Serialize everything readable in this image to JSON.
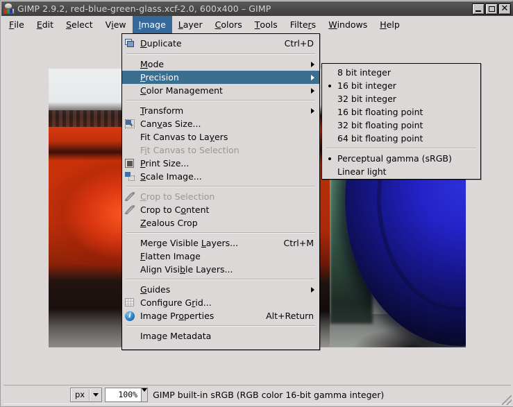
{
  "window": {
    "title": "GIMP 2.9.2, red-blue-green-glass.xcf-2.0, 600x400 – GIMP",
    "app_icon": "gimp-wilber-icon",
    "minimize_label": "_",
    "maximize_label": "□",
    "close_label": "✕"
  },
  "menubar": {
    "items": [
      {
        "label": "File",
        "mnemonic": "F",
        "active": false
      },
      {
        "label": "Edit",
        "mnemonic": "E",
        "active": false
      },
      {
        "label": "Select",
        "mnemonic": "S",
        "active": false
      },
      {
        "label": "View",
        "mnemonic": "V",
        "active": false
      },
      {
        "label": "Image",
        "mnemonic": "I",
        "active": true
      },
      {
        "label": "Layer",
        "mnemonic": "L",
        "active": false
      },
      {
        "label": "Colors",
        "mnemonic": "C",
        "active": false
      },
      {
        "label": "Tools",
        "mnemonic": "T",
        "active": false
      },
      {
        "label": "Filters",
        "mnemonic": "r",
        "active": false
      },
      {
        "label": "Windows",
        "mnemonic": "W",
        "active": false
      },
      {
        "label": "Help",
        "mnemonic": "H",
        "active": false
      }
    ]
  },
  "image_menu": {
    "title": "Image",
    "items": [
      {
        "label": "Duplicate",
        "accel": "Ctrl+D",
        "icon": "duplicate-icon"
      },
      {
        "type": "separator"
      },
      {
        "label": "Mode",
        "submenu": true
      },
      {
        "label": "Precision",
        "submenu": true,
        "selected": true
      },
      {
        "label": "Color Management",
        "submenu": true
      },
      {
        "type": "separator"
      },
      {
        "label": "Transform",
        "submenu": true
      },
      {
        "label": "Canvas Size...",
        "icon": "canvas-size-icon"
      },
      {
        "label": "Fit Canvas to Layers"
      },
      {
        "label": "Fit Canvas to Selection",
        "disabled": true
      },
      {
        "label": "Print Size...",
        "icon": "print-size-icon"
      },
      {
        "label": "Scale Image...",
        "icon": "scale-image-icon"
      },
      {
        "type": "separator"
      },
      {
        "label": "Crop to Selection",
        "icon": "crop-icon",
        "disabled": true
      },
      {
        "label": "Crop to Content",
        "icon": "crop-icon"
      },
      {
        "label": "Zealous Crop"
      },
      {
        "type": "separator"
      },
      {
        "label": "Merge Visible Layers...",
        "accel": "Ctrl+M"
      },
      {
        "label": "Flatten Image"
      },
      {
        "label": "Align Visible Layers..."
      },
      {
        "type": "separator"
      },
      {
        "label": "Guides",
        "submenu": true
      },
      {
        "label": "Configure Grid...",
        "icon": "grid-icon"
      },
      {
        "label": "Image Properties",
        "accel": "Alt+Return",
        "icon": "info-icon"
      },
      {
        "type": "separator"
      },
      {
        "label": "Image Metadata"
      }
    ]
  },
  "precision_menu": {
    "title": "Precision",
    "items": [
      {
        "label": "8 bit integer",
        "checked": false
      },
      {
        "label": "16 bit integer",
        "checked": true
      },
      {
        "label": "32 bit integer",
        "checked": false
      },
      {
        "label": "16 bit floating point",
        "checked": false
      },
      {
        "label": "32 bit floating point",
        "checked": false
      },
      {
        "label": "64 bit floating point",
        "checked": false
      },
      {
        "type": "separator"
      },
      {
        "label": "Perceptual gamma (sRGB)",
        "checked": true
      },
      {
        "label": "Linear light",
        "checked": false
      }
    ]
  },
  "statusbar": {
    "unit_value": "px",
    "zoom_value": "100%",
    "status_text": "GIMP built-in sRGB (RGB color 16-bit gamma integer)",
    "resize_grip": "resize-grip-icon"
  },
  "canvas": {
    "image_name": "red-blue-green-glass",
    "image_size": "600x400",
    "description": "Photograph of red, green and blue glass bottles"
  }
}
